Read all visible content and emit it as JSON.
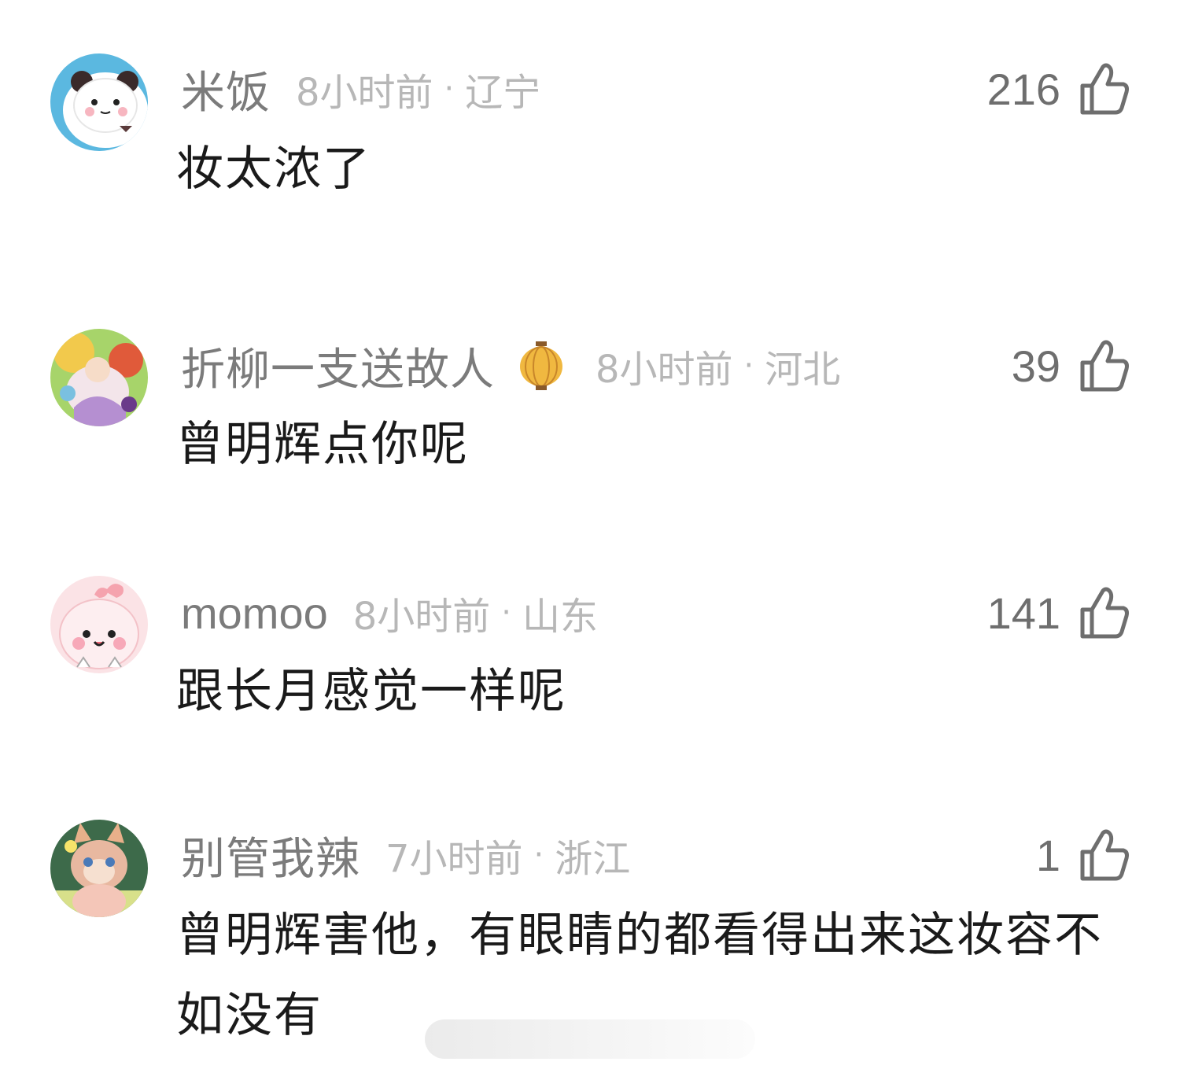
{
  "comments": [
    {
      "username": "米饭",
      "time": "8小时前",
      "separator": "·",
      "region": "辽宁",
      "likes": "216",
      "text": "妆太浓了",
      "avatar_icon": "panda-avatar-icon"
    },
    {
      "username": "折柳一支送故人",
      "badge_icon": "lantern-icon",
      "time": "8小时前",
      "separator": "·",
      "region": "河北",
      "likes": "39",
      "text": "曾明辉点你呢",
      "avatar_icon": "illustration-avatar-icon"
    },
    {
      "username": "momoo",
      "time": "8小时前",
      "separator": "·",
      "region": "山东",
      "likes": "141",
      "text": "跟长月感觉一样呢",
      "avatar_icon": "pink-creature-avatar-icon"
    },
    {
      "username": "别管我辣",
      "time": "7小时前",
      "separator": "·",
      "region": "浙江",
      "likes": "1",
      "text": "曾明辉害他，有眼睛的都看得出来这妆容不如没有",
      "avatar_icon": "plush-fox-avatar-icon"
    }
  ],
  "colors": {
    "username": "#7b7b7b",
    "meta": "#b7b7b7",
    "text": "#1a1a1a",
    "like_icon": "#6e6e6e"
  }
}
